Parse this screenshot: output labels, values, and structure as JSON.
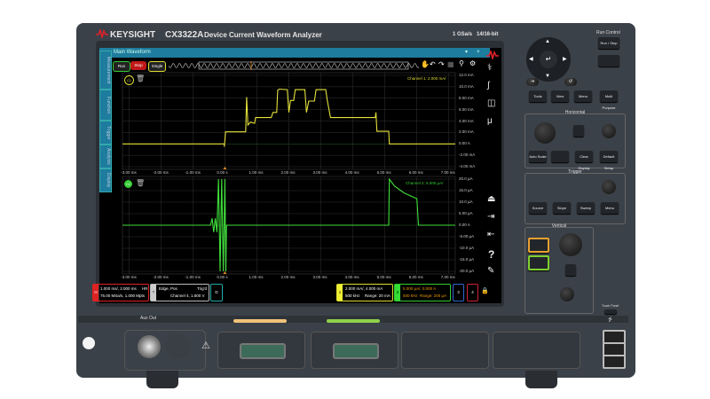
{
  "header": {
    "brand": "KEYSIGHT",
    "model": "CX3322A",
    "product": "Device Current Waveform Analyzer",
    "sample_rate": "1 GSa/s",
    "resolution": "14/16-bit"
  },
  "window": {
    "title": "Main Waveform",
    "menu_icon": "chevron-down-icon",
    "close": "×"
  },
  "side_tabs": [
    "Measurement",
    "Function",
    "Trigger",
    "Analysis",
    "Display"
  ],
  "run": {
    "run": "Run",
    "stop": "Stop",
    "single": "Single"
  },
  "graph1": {
    "badge": "C1",
    "channel_label": "Channel 1: 2.000 mA/",
    "color": "#e6e23a",
    "y_labels": [
      "12.0 mA",
      "10.0 mA",
      "8.00 mA",
      "6.00 mA",
      "4.00 mA",
      "2.00 mA",
      "0.00 A",
      "-2.00 mA",
      "-4.00 mA"
    ],
    "y_range_mA": [
      -4,
      12
    ],
    "x_labels": [
      "-3.00 ms",
      "-2.00 ms",
      "-1.00 ms",
      "0.00 s",
      "1.00 ms",
      "2.00 ms",
      "3.00 ms",
      "4.00 ms",
      "5.00 ms",
      "6.00 ms",
      "7.00 ms"
    ],
    "trace_ms_mA": [
      [
        -3.2,
        0
      ],
      [
        -0.02,
        0
      ],
      [
        -0.02,
        -0.5
      ],
      [
        0,
        0.6
      ],
      [
        0.02,
        2.1
      ],
      [
        0.65,
        2.1
      ],
      [
        0.68,
        8.2
      ],
      [
        0.72,
        3.3
      ],
      [
        0.8,
        3.8
      ],
      [
        0.93,
        3.6
      ],
      [
        0.96,
        4.6
      ],
      [
        1.45,
        4.6
      ],
      [
        1.5,
        5.5
      ],
      [
        1.62,
        5.5
      ],
      [
        1.65,
        9.4
      ],
      [
        1.7,
        9.6
      ],
      [
        1.95,
        9.5
      ],
      [
        2.0,
        5.5
      ],
      [
        2.05,
        7.6
      ],
      [
        2.15,
        7.6
      ],
      [
        2.2,
        9.5
      ],
      [
        2.5,
        9.5
      ],
      [
        2.55,
        5.5
      ],
      [
        2.62,
        7.5
      ],
      [
        2.8,
        7.5
      ],
      [
        2.85,
        9.5
      ],
      [
        3.15,
        9.5
      ],
      [
        3.2,
        7.6
      ],
      [
        3.3,
        4.6
      ],
      [
        4.7,
        4.6
      ],
      [
        4.72,
        5.5
      ],
      [
        4.75,
        2.2
      ],
      [
        5.12,
        2.2
      ],
      [
        5.14,
        0
      ],
      [
        7.2,
        0
      ]
    ]
  },
  "graph2": {
    "badge": "C2",
    "channel_label": "Channel 2: 5.000 µA/",
    "color": "#3fe03a",
    "y_labels": [
      "20.0 µA",
      "15.0 µA",
      "10.0 µA",
      "5.00 µA",
      "0.00 A",
      "-5.00 µA",
      "-10.0 µA",
      "-15.0 µA",
      "-20.0 µA"
    ],
    "y_range_uA": [
      -20,
      20
    ],
    "x_labels": [
      "-3.00 ms",
      "-2.00 ms",
      "-1.00 ms",
      "0.00 s",
      "1.00 ms",
      "2.00 ms",
      "3.00 ms",
      "4.00 ms",
      "5.00 ms",
      "6.00 ms",
      "7.00 ms"
    ],
    "trace_ms_uA": [
      [
        -3.2,
        0
      ],
      [
        -0.45,
        0
      ],
      [
        -0.4,
        3
      ],
      [
        -0.35,
        -3
      ],
      [
        -0.3,
        3
      ],
      [
        -0.25,
        -3
      ],
      [
        -0.2,
        20
      ],
      [
        -0.15,
        -20
      ],
      [
        -0.1,
        20
      ],
      [
        -0.05,
        -20
      ],
      [
        0,
        20
      ],
      [
        0.03,
        -20
      ],
      [
        0.05,
        0
      ],
      [
        5.12,
        0
      ],
      [
        5.14,
        20
      ],
      [
        5.3,
        17
      ],
      [
        5.6,
        14
      ],
      [
        6.0,
        11.5
      ],
      [
        6.05,
        0
      ],
      [
        7.2,
        0
      ]
    ]
  },
  "statusbar": {
    "horizontal": {
      "label": "H",
      "line1": "1.000 ms/, 2.000 ms",
      "mode": "HR",
      "line2": "75.00 MSa/s, 1.000 Mpts"
    },
    "trigger": {
      "label": "T",
      "line1": "Edge, Pos",
      "mode": "Trig'd",
      "line2": "Channel 4, 1.600 V"
    },
    "digital": {
      "label": "D"
    },
    "ch1": {
      "label": "1",
      "line1": "2.000 mA/, 4.000 mA",
      "bw": "500 kHz",
      "range": "Range: 20 mA"
    },
    "ch2": {
      "label": "2",
      "line1": "5.000 µA/, 0.000 A",
      "bw": "500 kHz",
      "range": "Range: 200 µA"
    },
    "ch3": {
      "label": "3"
    },
    "ch4": {
      "label": "4"
    }
  },
  "panel": {
    "run_control": "Run Control",
    "run_stop": "Run / Stop",
    "single": "Single",
    "tools": "Tools",
    "view": "View",
    "menu": "Menu",
    "multi_purpose": "Multi Purpose",
    "horizontal": "Horizontal",
    "auto_scale": "Auto Scale",
    "clear_display": "Clear Display",
    "default_setup": "Default Setup",
    "trigger": "Trigger",
    "level": "Level",
    "source": "Source",
    "slope": "Slope",
    "sweep": "Sweep",
    "trig_menu": "Menu",
    "vertical": "Vertical",
    "touch_panel": "Touch Panel"
  },
  "front": {
    "aux_out": "Aux Out"
  }
}
